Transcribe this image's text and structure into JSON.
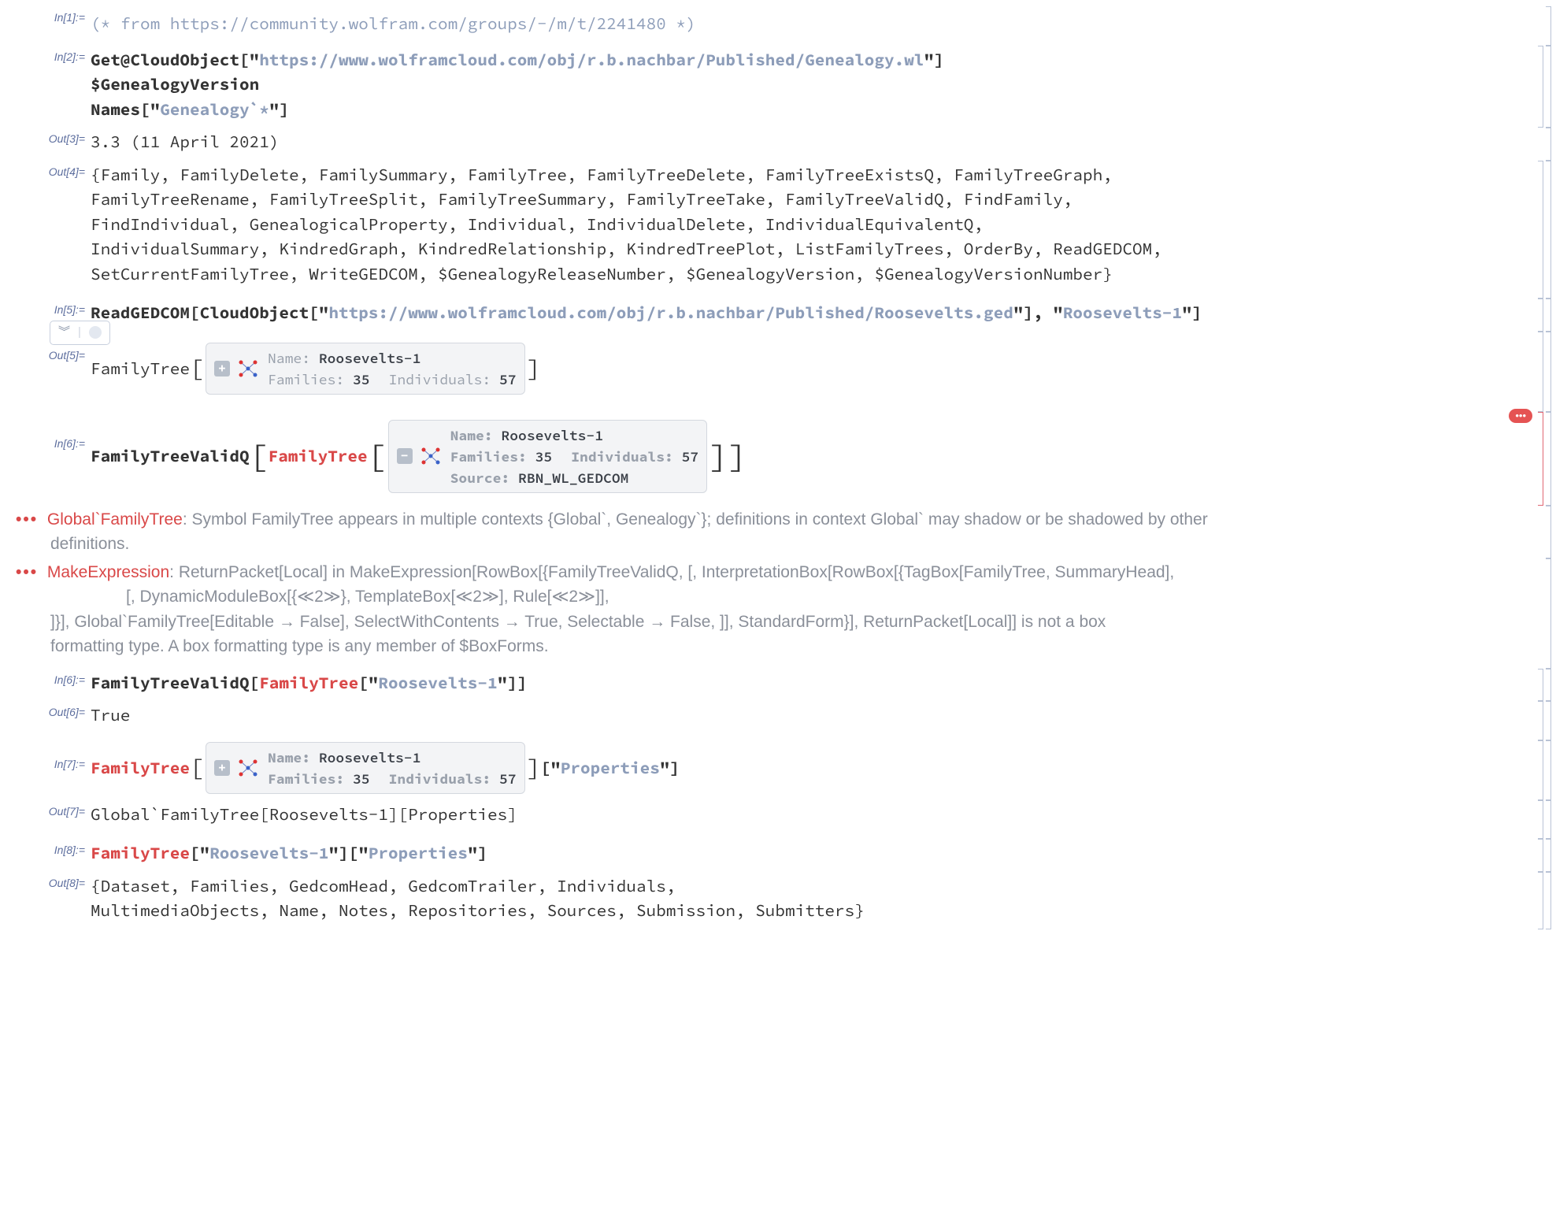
{
  "cells": {
    "in1": {
      "label": "In[1]:=",
      "comment": "(* from https://community.wolfram.com/groups/-/m/t/2241480  *)"
    },
    "in2": {
      "label": "In[2]:=",
      "l1_a": "Get@CloudObject[\"",
      "l1_url": "https://www.wolframcloud.com/obj/r.b.nachbar/Published/Genealogy.wl",
      "l1_b": "\"]",
      "l2": "$GenealogyVersion",
      "l3_a": "Names[\"",
      "l3_s": "Genealogy`*",
      "l3_b": "\"]"
    },
    "out3": {
      "label": "Out[3]=",
      "text": "3.3 (11 April 2021)"
    },
    "out4": {
      "label": "Out[4]=",
      "l1": "{Family, FamilyDelete, FamilySummary, FamilyTree, FamilyTreeDelete, FamilyTreeExistsQ, FamilyTreeGraph,",
      "l2": " FamilyTreeRename, FamilyTreeSplit, FamilyTreeSummary, FamilyTreeTake, FamilyTreeValidQ, FindFamily,",
      "l3": " FindIndividual, GenealogicalProperty, Individual, IndividualDelete, IndividualEquivalentQ,",
      "l4": " IndividualSummary, KindredGraph, KindredRelationship, KindredTreePlot, ListFamilyTrees, OrderBy, ReadGEDCOM,",
      "l5": " SetCurrentFamilyTree, WriteGEDCOM, $GenealogyReleaseNumber, $GenealogyVersion, $GenealogyVersionNumber}"
    },
    "in5": {
      "label": "In[5]:=",
      "a": "ReadGEDCOM[CloudObject[\"",
      "url": "https://www.wolframcloud.com/obj/r.b.nachbar/Published/Roosevelts.ged",
      "b": "\"], \"",
      "str": "Roosevelts-1",
      "c": "\"]"
    },
    "float": {
      "chev": "︾"
    },
    "out5": {
      "label": "Out[5]=",
      "head": "FamilyTree",
      "name_lbl": "Name: ",
      "name_val": "Roosevelts-1",
      "fam_lbl": "Families: ",
      "fam_val": "35",
      "ind_lbl": "Individuals: ",
      "ind_val": "57",
      "toggle": "+"
    },
    "in6a": {
      "label": "In[6]:=",
      "a": "FamilyTreeValidQ",
      "b": "FamilyTree",
      "name_lbl": "Name: ",
      "name_val": "Roosevelts-1",
      "fam_lbl": "Families: ",
      "fam_val": "35",
      "ind_lbl": "Individuals: ",
      "ind_val": "57",
      "src_lbl": "Source: ",
      "src_val": "RBN_WL_GEDCOM",
      "toggle": "−"
    },
    "err_bubble": "•••",
    "msg1": {
      "dots": "•••",
      "head": "Global`FamilyTree",
      "colon": ": ",
      "text_a": "Symbol FamilyTree appears in multiple contexts {Global`, Genealogy`}; definitions in context Global` may shadow or be shadowed by other",
      "text_b": "definitions."
    },
    "msg2": {
      "dots": "•••",
      "head": "MakeExpression",
      "colon": ": ",
      "l1": "ReturnPacket[Local] in MakeExpression[RowBox[{FamilyTreeValidQ, [, InterpretationBox[RowBox[{TagBox[FamilyTree, SummaryHead],",
      "l2": "[, DynamicModuleBox[{≪2≫}, TemplateBox[≪2≫], Rule[≪2≫]],",
      "l3": "]}], Global`FamilyTree[Editable → False], SelectWithContents → True, Selectable → False, ]], StandardForm}], ReturnPacket[Local]] is not a box",
      "l4": "formatting type. A box formatting type is any member of $BoxForms."
    },
    "in6b": {
      "label": "In[6]:=",
      "a": "FamilyTreeValidQ[",
      "b": "FamilyTree",
      "c": "[\"",
      "s": "Roosevelts-1",
      "d": "\"]]"
    },
    "out6": {
      "label": "Out[6]=",
      "text": "True"
    },
    "in7": {
      "label": "In[7]:=",
      "a": "FamilyTree",
      "name_lbl": "Name: ",
      "name_val": "Roosevelts-1",
      "fam_lbl": "Families: ",
      "fam_val": "35",
      "ind_lbl": "Individuals: ",
      "ind_val": "57",
      "toggle": "+",
      "b": "[\"",
      "s": "Properties",
      "c": "\"]"
    },
    "out7": {
      "label": "Out[7]=",
      "text": "Global`FamilyTree[Roosevelts-1][Properties]"
    },
    "in8": {
      "label": "In[8]:=",
      "a": "FamilyTree",
      "b": "[\"",
      "s1": "Roosevelts-1",
      "c": "\"][\"",
      "s2": "Properties",
      "d": "\"]"
    },
    "out8": {
      "label": "Out[8]=",
      "l1": "{Dataset, Families, GedcomHead, GedcomTrailer, Individuals,",
      "l2": " MultimediaObjects, Name, Notes, Repositories, Sources, Submission, Submitters}"
    }
  }
}
